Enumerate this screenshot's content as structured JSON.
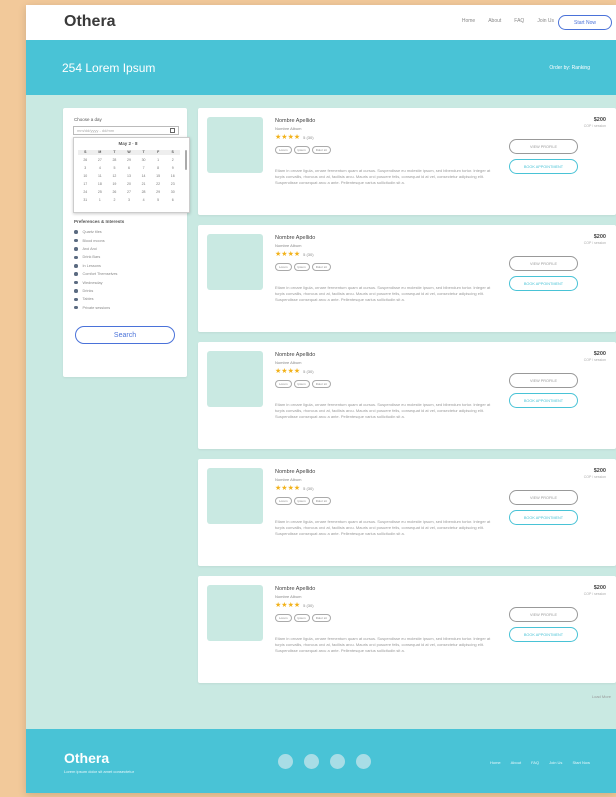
{
  "header": {
    "brand": "Othera",
    "nav": [
      "Home",
      "About",
      "FAQ",
      "Join Us"
    ],
    "start_button": "Start Now"
  },
  "hero": {
    "title": "254 Lorem Ipsum",
    "sort": "Order by: Ranking"
  },
  "sidebar": {
    "date_label": "Choose a day",
    "date_placeholder": "mm/dd/yyyy ‑ dd/mm",
    "calendar_month": "May 2 · 8",
    "calendar_head": [
      "S",
      "M",
      "T",
      "W",
      "T",
      "F",
      "S"
    ],
    "calendar_days": [
      "26",
      "27",
      "28",
      "29",
      "30",
      "1",
      "2",
      "3",
      "4",
      "5",
      "6",
      "7",
      "8",
      "9",
      "10",
      "11",
      "12",
      "13",
      "14",
      "15",
      "16",
      "17",
      "18",
      "19",
      "20",
      "21",
      "22",
      "23",
      "24",
      "25",
      "26",
      "27",
      "28",
      "29",
      "30",
      "31",
      "1",
      "2",
      "3",
      "4",
      "5",
      "6"
    ],
    "preferences_label": "Preferences & Interests",
    "preferences": [
      "Quartz tiles",
      "Blood moons",
      "Aroi Aroi",
      "Drink Bars",
      "In Lessons",
      "Comfort Themselves",
      "Wednesday",
      "Drinks",
      "Tables",
      "Private sessions"
    ],
    "search_button": "Search"
  },
  "cards": [
    {
      "name": "Nombre Apellido",
      "subtitle": "Nombre Album",
      "rating": "5 (30)",
      "tags": [
        "Lorem",
        "Ipsum",
        "Dolor sit"
      ],
      "description": "Etiam in ornare ligula, ornare fermentum quam at cursus. Suspendisse eu molestie ipsum, sed bibendum tortor. Integer at turpis convallis, rhoncus orci at, facilisis arcu. Mauris orci posuere felis, consequat id at vel, consectetur adipiscing elit. Suspendisse consequat arcu a ante. Pellentesque varius sollicitudin sit a.",
      "price": "$200",
      "per": "COP / session",
      "view_button": "VIEW PROFILE",
      "book_button": "BOOK APPOINTMENT"
    },
    {
      "name": "Nombre Apellido",
      "subtitle": "Nombre Album",
      "rating": "5 (30)",
      "tags": [
        "Lorem",
        "Ipsum",
        "Dolor sit"
      ],
      "description": "Etiam in ornare ligula, ornare fermentum quam at cursus. Suspendisse eu molestie ipsum, sed bibendum tortor. Integer at turpis convallis, rhoncus orci at, facilisis arcu. Mauris orci posuere felis, consequat id at vel, consectetur adipiscing elit. Suspendisse consequat arcu a ante. Pellentesque varius sollicitudin sit a.",
      "price": "$200",
      "per": "COP / session",
      "view_button": "VIEW PROFILE",
      "book_button": "BOOK APPOINTMENT"
    },
    {
      "name": "Nombre Apellido",
      "subtitle": "Nombre Album",
      "rating": "5 (30)",
      "tags": [
        "Lorem",
        "Ipsum",
        "Dolor sit"
      ],
      "description": "Etiam in ornare ligula, ornare fermentum quam at cursus. Suspendisse eu molestie ipsum, sed bibendum tortor. Integer at turpis convallis, rhoncus orci at, facilisis arcu. Mauris orci posuere felis, consequat id at vel, consectetur adipiscing elit. Suspendisse consequat arcu a ante. Pellentesque varius sollicitudin sit a.",
      "price": "$200",
      "per": "COP / session",
      "view_button": "VIEW PROFILE",
      "book_button": "BOOK APPOINTMENT"
    },
    {
      "name": "Nombre Apellido",
      "subtitle": "Nombre Album",
      "rating": "5 (30)",
      "tags": [
        "Lorem",
        "Ipsum",
        "Dolor sit"
      ],
      "description": "Etiam in ornare ligula, ornare fermentum quam at cursus. Suspendisse eu molestie ipsum, sed bibendum tortor. Integer at turpis convallis, rhoncus orci at, facilisis arcu. Mauris orci posuere felis, consequat id at vel, consectetur adipiscing elit. Suspendisse consequat arcu a ante. Pellentesque varius sollicitudin sit a.",
      "price": "$200",
      "per": "COP / session",
      "view_button": "VIEW PROFILE",
      "book_button": "BOOK APPOINTMENT"
    },
    {
      "name": "Nombre Apellido",
      "subtitle": "Nombre Album",
      "rating": "5 (30)",
      "tags": [
        "Lorem",
        "Ipsum",
        "Dolor sit"
      ],
      "description": "Etiam in ornare ligula, ornare fermentum quam at cursus. Suspendisse eu molestie ipsum, sed bibendum tortor. Integer at turpis convallis, rhoncus orci at, facilisis arcu. Mauris orci posuere felis, consequat id at vel, consectetur adipiscing elit. Suspendisse consequat arcu a ante. Pellentesque varius sollicitudin sit a.",
      "price": "$200",
      "per": "COP / session",
      "view_button": "VIEW PROFILE",
      "book_button": "BOOK APPOINTMENT"
    }
  ],
  "load_more": "Load More",
  "footer": {
    "brand": "Othera",
    "tagline": "Lorem ipsum dolor sit amet consectetur",
    "links": [
      "Home",
      "About",
      "FAQ",
      "Join Us",
      "Start Now"
    ],
    "social_icons": [
      "social-circle-icon",
      "social-circle-icon",
      "social-circle-icon",
      "social-circle-icon"
    ]
  },
  "colors": {
    "accent": "#49c3d6",
    "link_blue": "#4a72d9",
    "background": "#c9e9e2",
    "star": "#f2b21b",
    "outer": "#f2c99a"
  }
}
